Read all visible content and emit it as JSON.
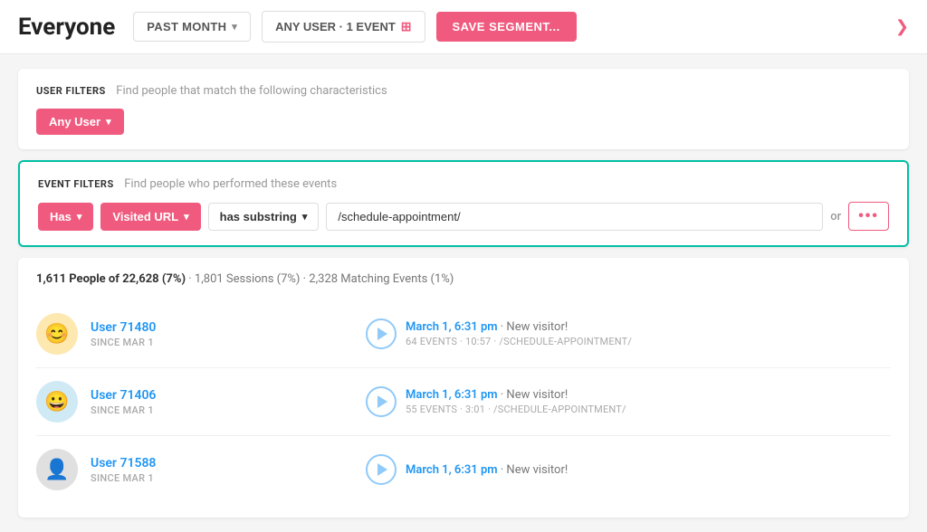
{
  "header": {
    "title": "Everyone",
    "time_filter_label": "PAST MONTH",
    "event_filter_label": "ANY USER · 1 EVENT",
    "save_button_label": "SAVE SEGMENT...",
    "chevron_symbol": "❯"
  },
  "user_filters": {
    "section_label": "USER FILTERS",
    "section_desc": "Find people that match the following characteristics",
    "any_user_label": "Any User"
  },
  "event_filters": {
    "section_label": "EVENT FILTERS",
    "section_desc": "Find people who performed these events",
    "has_label": "Has",
    "visited_url_label": "Visited URL",
    "has_substring_label": "has substring",
    "url_value": "/schedule-appointment/",
    "or_label": "or",
    "dots_label": "•••"
  },
  "results": {
    "summary": "1,611 People of 22,628 (7%)",
    "sessions": "1,801 Sessions (7%)",
    "matching_events": "2,328 Matching Events (1%)",
    "users": [
      {
        "name": "User 71480",
        "since": "SINCE MAR 1",
        "avatar_type": "smiley",
        "event_time": "March 1, 6:31 pm",
        "event_desc": "New visitor!",
        "event_meta": "64 EVENTS · 10:57 · /SCHEDULE-APPOINTMENT/"
      },
      {
        "name": "User 71406",
        "since": "SINCE MAR 1",
        "avatar_type": "happy",
        "event_time": "March 1, 6:31 pm",
        "event_desc": "New visitor!",
        "event_meta": "55 EVENTS · 3:01 · /SCHEDULE-APPOINTMENT/"
      },
      {
        "name": "User 71588",
        "since": "SINCE MAR 1",
        "avatar_type": "neutral",
        "event_time": "March 1, 6:31 pm",
        "event_desc": "New visitor!",
        "event_meta": ""
      }
    ]
  },
  "icons": {
    "chevron_down": "▾",
    "play": "▶",
    "dots": "•••",
    "chevron_right": "❯"
  }
}
